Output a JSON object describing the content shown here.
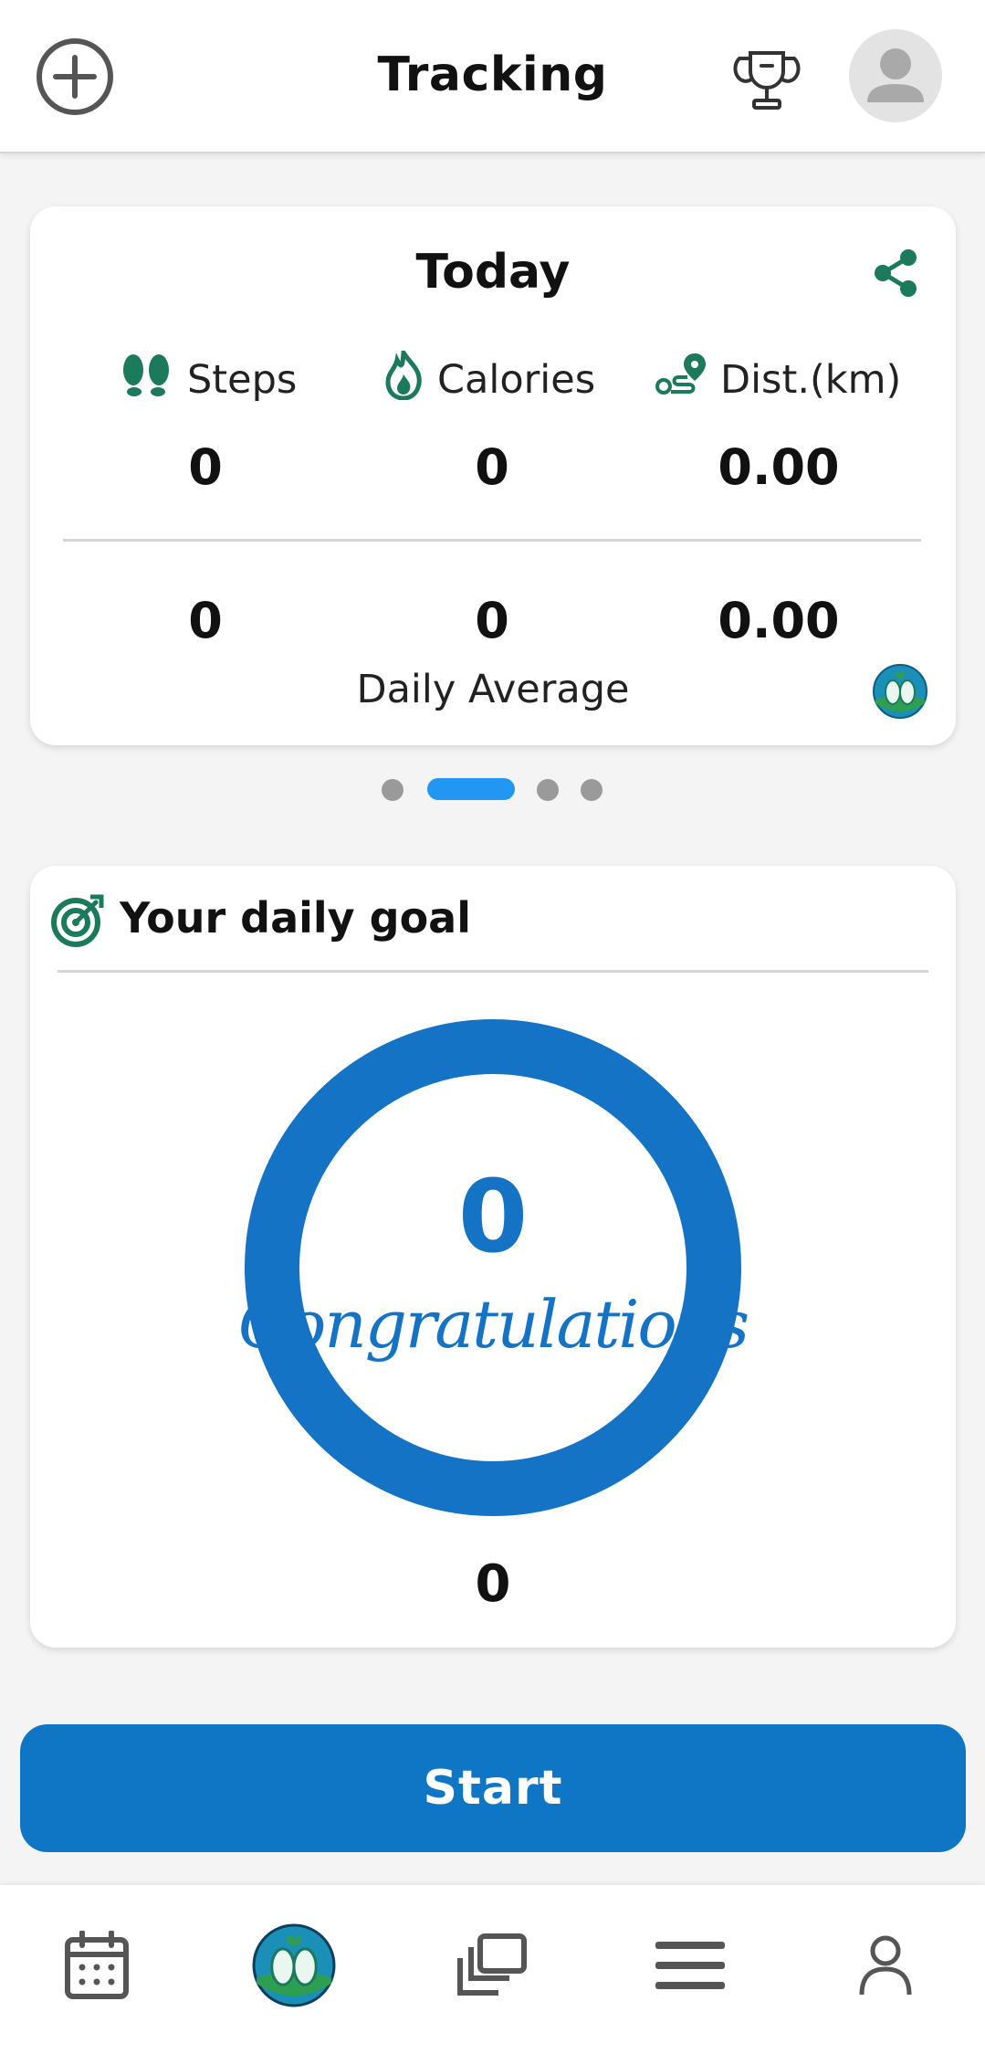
{
  "header": {
    "title": "Tracking",
    "add_icon": "plus-circle-icon",
    "trophy_icon": "trophy-icon",
    "avatar_icon": "user-avatar-icon"
  },
  "today": {
    "title": "Today",
    "share_icon": "share-icon",
    "stats": [
      {
        "label": "Steps",
        "icon": "footprints-icon",
        "today": "0",
        "average": "0"
      },
      {
        "label": "Calories",
        "icon": "flame-icon",
        "today": "0",
        "average": "0"
      },
      {
        "label": "Dist.(km)",
        "icon": "route-icon",
        "today": "0.00",
        "average": "0.00"
      }
    ],
    "average_label": "Daily Average",
    "logo_icon": "app-logo-icon"
  },
  "pager": {
    "count": 4,
    "active_index": 1
  },
  "goal": {
    "title": "Your daily goal",
    "icon": "target-icon",
    "value": "0",
    "message": "Congratulations",
    "footer_value": "0",
    "progress": 1.0
  },
  "start_button": {
    "label": "Start"
  },
  "nav": [
    {
      "name": "calendar",
      "icon": "calendar-icon"
    },
    {
      "name": "home",
      "icon": "app-logo-icon"
    },
    {
      "name": "gallery",
      "icon": "gallery-icon"
    },
    {
      "name": "menu",
      "icon": "menu-icon"
    },
    {
      "name": "profile",
      "icon": "person-icon"
    }
  ],
  "colors": {
    "accent": "#0f76c6",
    "ring": "#1473c4",
    "dot_active": "#2196f3",
    "dot_inactive": "#9a9a9a",
    "icon_green": "#1c7a5c"
  }
}
